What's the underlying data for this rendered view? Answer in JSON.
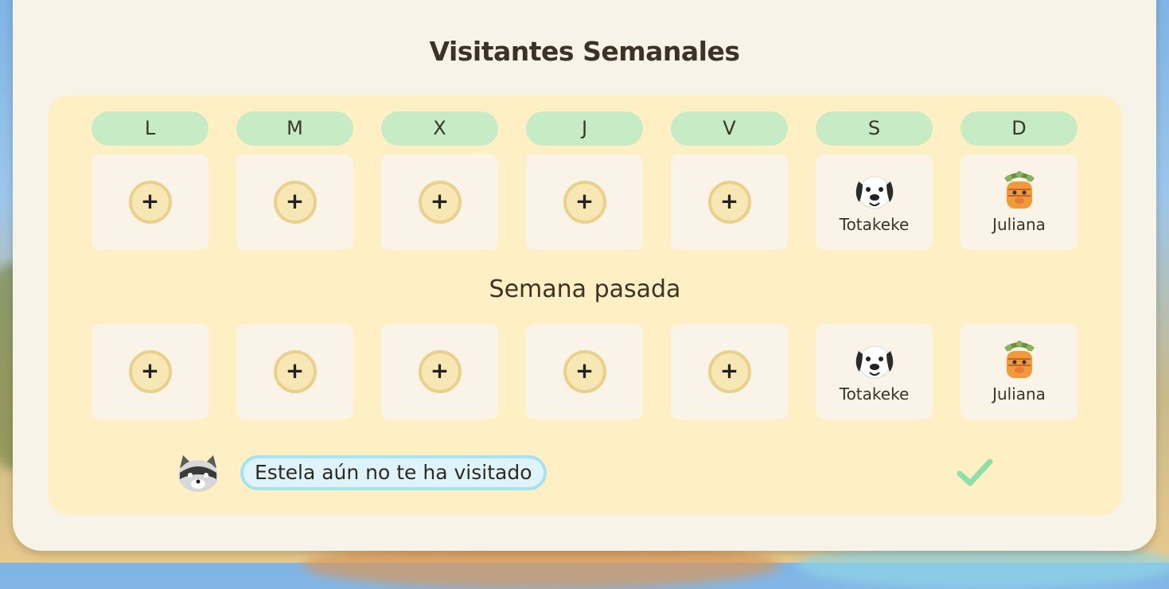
{
  "title": "Visitantes Semanales",
  "days": [
    "L",
    "M",
    "X",
    "J",
    "V",
    "S",
    "D"
  ],
  "current_week": {
    "slots": [
      {
        "type": "add",
        "label": "+"
      },
      {
        "type": "add",
        "label": "+"
      },
      {
        "type": "add",
        "label": "+"
      },
      {
        "type": "add",
        "label": "+"
      },
      {
        "type": "add",
        "label": "+"
      },
      {
        "type": "villager",
        "name": "Totakeke",
        "icon": "dog-icon"
      },
      {
        "type": "villager",
        "name": "Juliana",
        "icon": "juliana-icon"
      }
    ]
  },
  "last_week_title": "Semana pasada",
  "last_week": {
    "slots": [
      {
        "type": "add",
        "label": "+"
      },
      {
        "type": "add",
        "label": "+"
      },
      {
        "type": "add",
        "label": "+"
      },
      {
        "type": "add",
        "label": "+"
      },
      {
        "type": "add",
        "label": "+"
      },
      {
        "type": "villager",
        "name": "Totakeke",
        "icon": "dog-icon"
      },
      {
        "type": "villager",
        "name": "Juliana",
        "icon": "juliana-icon"
      }
    ]
  },
  "footer": {
    "message": "Estela aún no te ha visitado",
    "avatar_icon": "raccoon-icon",
    "confirm_icon": "checkmark-icon"
  },
  "colors": {
    "panel": "#f8f3e9",
    "board": "#ffefc4",
    "day_pill": "#c7ecc5",
    "add_button_ring": "#ead08d",
    "message_border": "#a7e2ee",
    "check": "#8fe0a8"
  }
}
